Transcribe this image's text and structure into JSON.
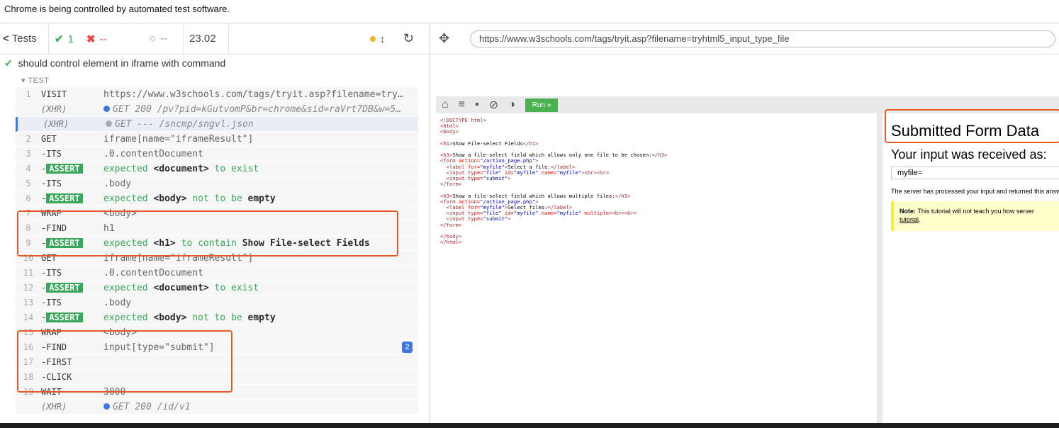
{
  "automation_banner": "Chrome is being controlled by automated test software.",
  "runner": {
    "tests_label": "Tests",
    "passed_count": "1",
    "failed_count": "--",
    "pending_count": "--",
    "duration": "23.02",
    "suite_title": "should control element in iframe with command",
    "test_section_label": "TEST",
    "commands": [
      {
        "num": "1",
        "name": "VISIT",
        "msg": "https://www.w3schools.com/tags/tryit.asp?filename=try…"
      },
      {
        "num": "",
        "name": "(XHR)",
        "msg": "GET 200 /pv?pid=kGutvomP&br=chrome&sid=raVrt7DB&w=5…"
      },
      {
        "num": "",
        "name": "(XHR)",
        "msg": "GET --- /sncmp/sngvl.json"
      },
      {
        "num": "2",
        "name": "GET",
        "msg": "iframe[name=\"iframeResult\"]"
      },
      {
        "num": "3",
        "name": "-ITS",
        "msg": ".0.contentDocument"
      },
      {
        "num": "4",
        "name": "-ASSERT",
        "msg_parts": [
          "expected ",
          "<document>",
          " to exist"
        ]
      },
      {
        "num": "5",
        "name": "-ITS",
        "msg": ".body"
      },
      {
        "num": "6",
        "name": "-ASSERT",
        "msg_parts": [
          "expected ",
          "<body>",
          " not to be ",
          "empty"
        ]
      },
      {
        "num": "7",
        "name": "WRAP",
        "msg": "<body>"
      },
      {
        "num": "8",
        "name": "-FIND",
        "msg": "h1"
      },
      {
        "num": "9",
        "name": "-ASSERT",
        "msg_parts": [
          "expected ",
          "<h1>",
          " to contain ",
          "Show File-select Fields"
        ]
      },
      {
        "num": "10",
        "name": "GET",
        "msg": "iframe[name=\"iframeResult\"]"
      },
      {
        "num": "11",
        "name": "-ITS",
        "msg": ".0.contentDocument"
      },
      {
        "num": "12",
        "name": "-ASSERT",
        "msg_parts": [
          "expected ",
          "<document>",
          " to exist"
        ]
      },
      {
        "num": "13",
        "name": "-ITS",
        "msg": ".body"
      },
      {
        "num": "14",
        "name": "-ASSERT",
        "msg_parts": [
          "expected ",
          "<body>",
          " not to be ",
          "empty"
        ]
      },
      {
        "num": "15",
        "name": "WRAP",
        "msg": "<body>"
      },
      {
        "num": "16",
        "name": "-FIND",
        "msg": "input[type=\"submit\"]",
        "badge": "2"
      },
      {
        "num": "17",
        "name": "-FIRST",
        "msg": ""
      },
      {
        "num": "18",
        "name": "-CLICK",
        "msg": ""
      },
      {
        "num": "19",
        "name": "WAIT",
        "msg": "3000"
      },
      {
        "num": "",
        "name": "(XHR)",
        "msg": "GET 200 /id/v1"
      }
    ]
  },
  "aut": {
    "url": "https://www.w3schools.com/tags/tryit.asp?filename=tryhtml5_input_type_file",
    "run_label": "Run »",
    "result": {
      "heading": "Submitted Form Data",
      "subheading": "Your input was received as:",
      "input_value": "myfile=",
      "processed_text": "The server has processed your input and returned this answer.",
      "note_label": "Note:",
      "note_text": " This tutorial will not teach you how server",
      "note_link": "tutorial",
      "note_tail": "."
    }
  },
  "colors": {
    "pass": "#3dae5a",
    "fail": "#e94848",
    "highlight": "#e8592a",
    "run_button": "#4caf50"
  }
}
